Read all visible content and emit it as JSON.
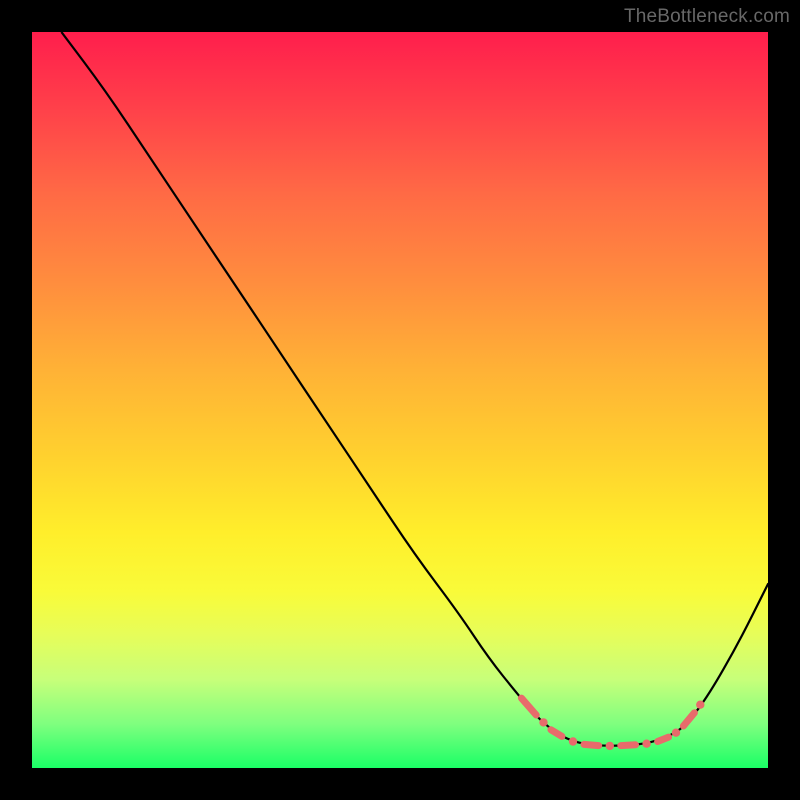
{
  "watermark": "TheBottleneck.com",
  "chart_data": {
    "type": "line",
    "title": "",
    "xlabel": "",
    "ylabel": "",
    "xlim": [
      0,
      100
    ],
    "ylim": [
      0,
      100
    ],
    "curve_points": [
      [
        4,
        100
      ],
      [
        10,
        92
      ],
      [
        16,
        83
      ],
      [
        22,
        74
      ],
      [
        28,
        65
      ],
      [
        34,
        56
      ],
      [
        40,
        47
      ],
      [
        46,
        38
      ],
      [
        52,
        29
      ],
      [
        58,
        21
      ],
      [
        62,
        15
      ],
      [
        66,
        10
      ],
      [
        69,
        6.5
      ],
      [
        72,
        4.2
      ],
      [
        75,
        3.2
      ],
      [
        78,
        3.0
      ],
      [
        81,
        3.1
      ],
      [
        84,
        3.4
      ],
      [
        87,
        4.5
      ],
      [
        89,
        6.0
      ],
      [
        92,
        10
      ],
      [
        96,
        17
      ],
      [
        100,
        25
      ]
    ],
    "marker_segments": [
      {
        "type": "dash",
        "x1": 66.5,
        "y1": 9.5,
        "x2": 68.5,
        "y2": 7.2
      },
      {
        "type": "dot",
        "x": 69.5,
        "y": 6.2
      },
      {
        "type": "dash",
        "x1": 70.5,
        "y1": 5.2,
        "x2": 72.0,
        "y2": 4.3
      },
      {
        "type": "dot",
        "x": 73.5,
        "y": 3.6
      },
      {
        "type": "dash",
        "x1": 75.0,
        "y1": 3.2,
        "x2": 77.0,
        "y2": 3.05
      },
      {
        "type": "dot",
        "x": 78.5,
        "y": 3.0
      },
      {
        "type": "dash",
        "x1": 80.0,
        "y1": 3.05,
        "x2": 82.0,
        "y2": 3.15
      },
      {
        "type": "dot",
        "x": 83.5,
        "y": 3.3
      },
      {
        "type": "dash",
        "x1": 85.0,
        "y1": 3.6,
        "x2": 86.5,
        "y2": 4.2
      },
      {
        "type": "dot",
        "x": 87.5,
        "y": 4.8
      },
      {
        "type": "dash",
        "x1": 88.5,
        "y1": 5.7,
        "x2": 90.0,
        "y2": 7.5
      },
      {
        "type": "dot",
        "x": 90.8,
        "y": 8.6
      }
    ],
    "gradient_stops_comment": "vertical gradient red→yellow→green as background, darker at top, green at bottom"
  }
}
